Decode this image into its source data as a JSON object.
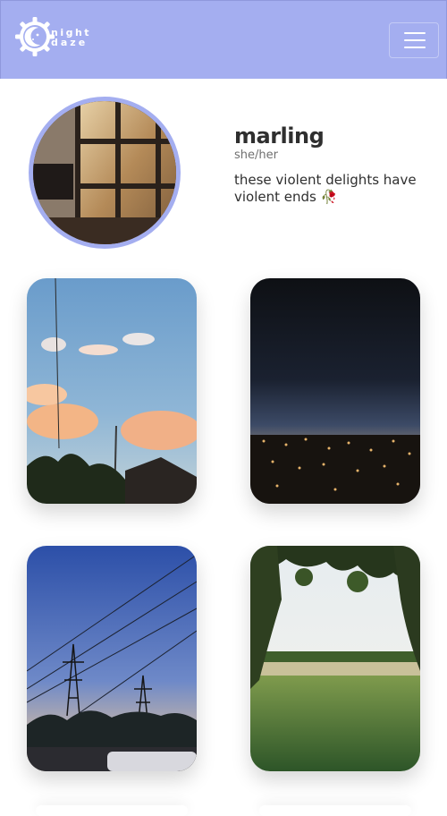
{
  "navbar": {
    "brand_line1": "night",
    "brand_line2": "daze",
    "bg_color": "#a4aef0",
    "menu_icon": "hamburger-icon"
  },
  "profile": {
    "name": "marling",
    "pronouns": "she/her",
    "bio": "these violent delights have violent ends 🥀",
    "accent_color": "#a4aef0"
  },
  "photos": [
    {
      "subject": "sunset clouds over houses"
    },
    {
      "subject": "night harbour lights"
    },
    {
      "subject": "power lines at dusk"
    },
    {
      "subject": "green field under trees"
    }
  ]
}
